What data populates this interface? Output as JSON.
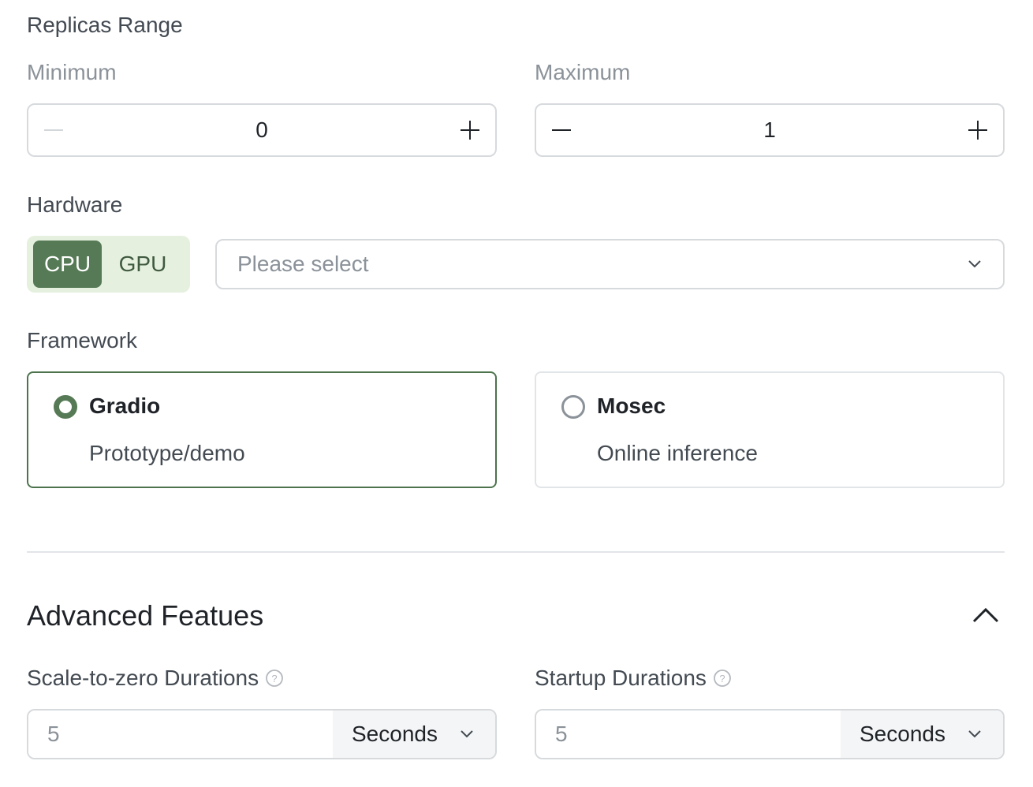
{
  "replicas": {
    "section_label": "Replicas Range",
    "minimum": {
      "label": "Minimum",
      "value": "0",
      "decrement_disabled": true
    },
    "maximum": {
      "label": "Maximum",
      "value": "1",
      "decrement_disabled": false
    }
  },
  "hardware": {
    "label": "Hardware",
    "options": [
      "CPU",
      "GPU"
    ],
    "selected": "CPU",
    "select_placeholder": "Please select"
  },
  "framework": {
    "label": "Framework",
    "options": [
      {
        "title": "Gradio",
        "description": "Prototype/demo",
        "selected": true
      },
      {
        "title": "Mosec",
        "description": "Online inference",
        "selected": false
      }
    ]
  },
  "advanced": {
    "title": "Advanced Featues",
    "collapse_icon": "chevron-up-icon",
    "scale_to_zero": {
      "label": "Scale-to-zero Durations",
      "placeholder": "5",
      "unit": "Seconds"
    },
    "startup": {
      "label": "Startup Durations",
      "placeholder": "5",
      "unit": "Seconds"
    }
  },
  "colors": {
    "accent": "#557a55",
    "accent_bg": "#e5f0df",
    "border": "#d7dadd"
  }
}
